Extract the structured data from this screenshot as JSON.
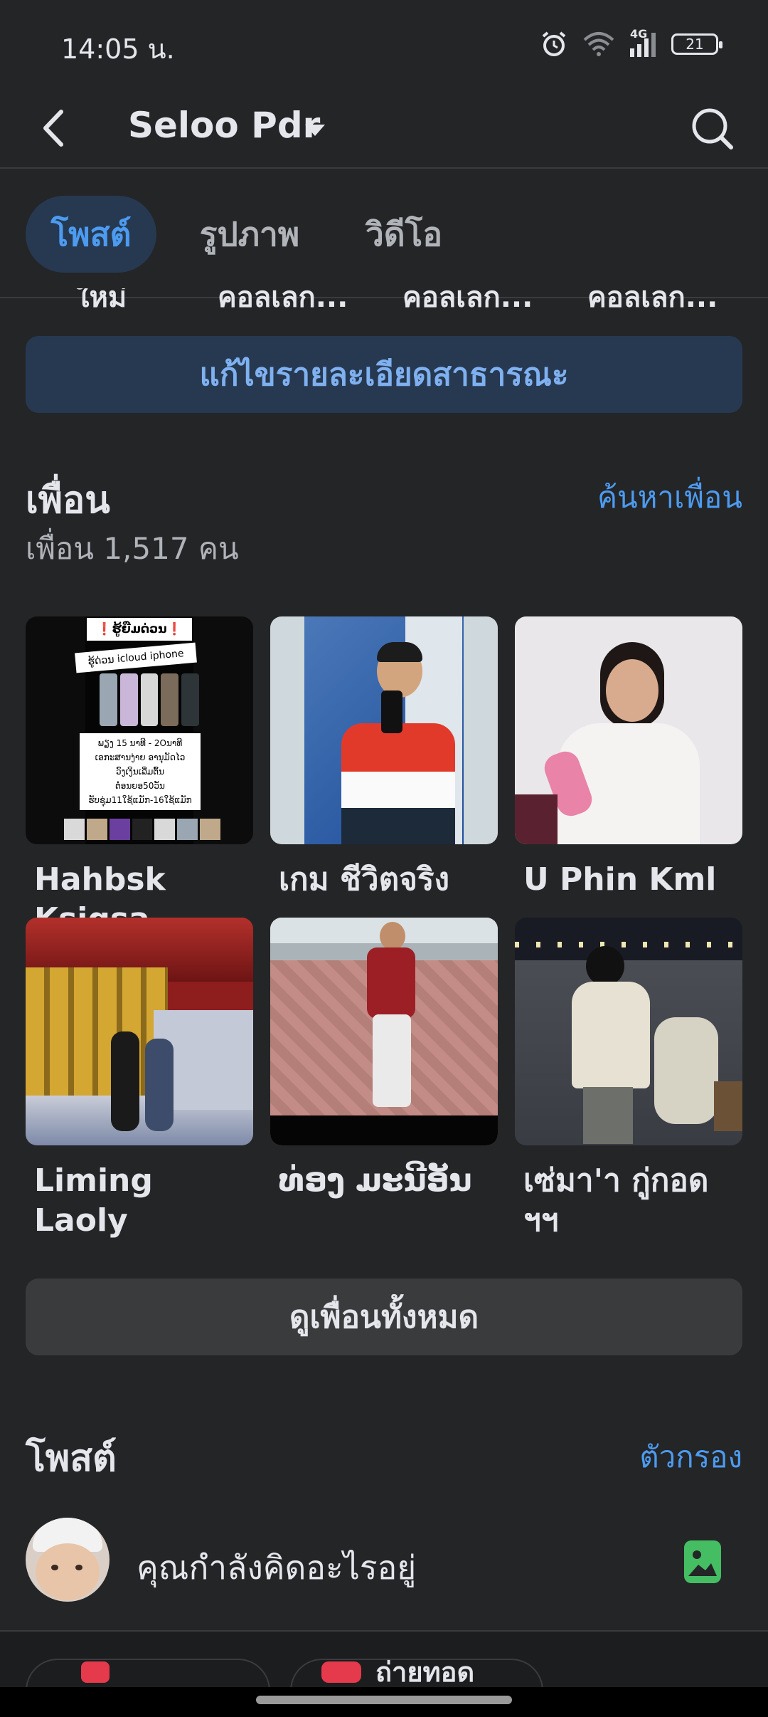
{
  "status": {
    "time": "14:05 น.",
    "battery": "21",
    "network": "4G"
  },
  "header": {
    "title": "Seloo Pdr"
  },
  "tabs": [
    {
      "label": "โพสต์",
      "active": true
    },
    {
      "label": "รูปภาพ",
      "active": false
    },
    {
      "label": "วิดีโอ",
      "active": false
    }
  ],
  "cut_row": [
    "ใหม่",
    "คอลเลก...",
    "คอลเลก...",
    "คอลเลก..."
  ],
  "edit_button": "แก้ไขรายละเอียดสาธารณะ",
  "friends": {
    "title": "เพื่อน",
    "find_link": "ค้นหาเพื่อน",
    "count_text": "เพื่อน 1,517 คน",
    "items": [
      {
        "name": "Hahbsk Ksigsa"
      },
      {
        "name": "เกม ชีวิตจริง"
      },
      {
        "name": "U Phin Kml"
      },
      {
        "name": "Liming Laoly"
      },
      {
        "name": "ທ່ອງ ມະນີອັນ"
      },
      {
        "name": "เซ่มา'า กู่กอด ฯฯ"
      }
    ],
    "ad_text": {
      "headline": "❗ຮູ້ຍືມດ່ວນ❗",
      "tag": "ຮູ້ດ່ວນ icloud iphone",
      "line1": "ພຽງ 15 ນາທີ - 2Oນາທີ",
      "line2": "ເອກະສານງ່າຍ ອານຸມັດໄວ",
      "line3": "ວົງເງິນເລີ່ມຕົ້ນ",
      "line4": "ຕໍ່ອນຍອ50ວັນ",
      "line5": "ຮັບຊຸ່ມ11ໃຊ້ແມັກ-16ໃຊ້ແມັກ"
    }
  },
  "see_all": "ดูเพื่อนทั้งหมด",
  "posts": {
    "title": "โพสต์",
    "filter": "ตัวกรอง",
    "composer_placeholder": "คุณกำลังคิดอะไรอยู่"
  },
  "bottom_chips": [
    "",
    "ถ่ายทอด"
  ],
  "colors": {
    "background": "#242527",
    "accent": "#4c9bf0",
    "tab_active_bg": "#263951"
  }
}
